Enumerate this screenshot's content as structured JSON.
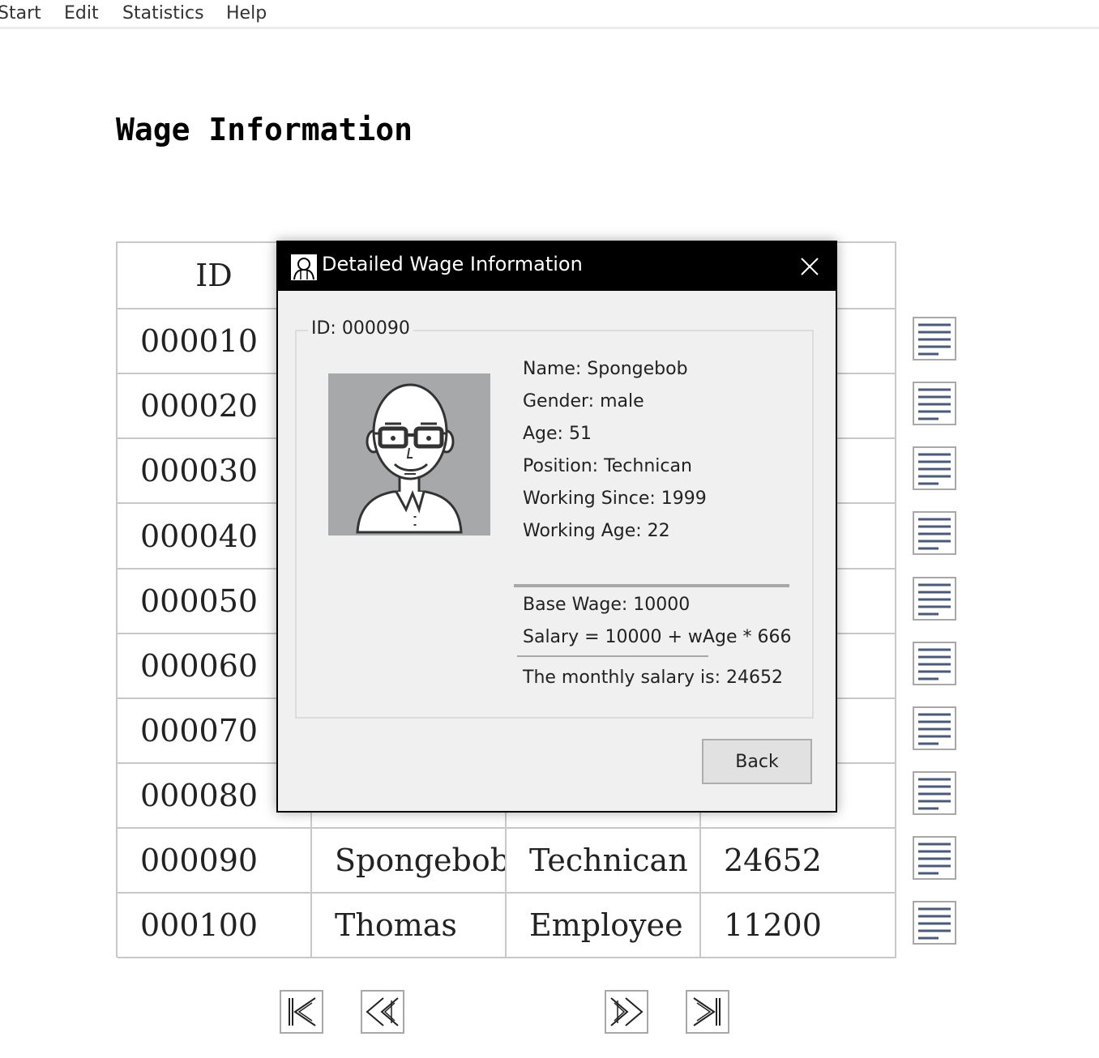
{
  "menu": {
    "items": [
      "Start",
      "Edit",
      "Statistics",
      "Help"
    ]
  },
  "page": {
    "title": "Wage Information"
  },
  "table": {
    "header": {
      "id": "ID"
    },
    "rows": [
      {
        "id": "000010"
      },
      {
        "id": "000020"
      },
      {
        "id": "000030"
      },
      {
        "id": "000040"
      },
      {
        "id": "000050"
      },
      {
        "id": "000060"
      },
      {
        "id": "000070"
      },
      {
        "id": "000080"
      },
      {
        "id": "000090",
        "name": "Spongebob",
        "position": "Technican",
        "salary": "24652"
      },
      {
        "id": "000100",
        "name": "Thomas",
        "position": "Employee",
        "salary": "11200"
      }
    ]
  },
  "dialog": {
    "title": "Detailed Wage Information",
    "group_label": "ID: 000090",
    "name": "Name: Spongebob",
    "gender": "Gender: male",
    "age": "Age: 51",
    "position": "Position: Technican",
    "working_since": "Working Since: 1999",
    "working_age": "Working Age: 22",
    "base_wage": "Base Wage: 10000",
    "formula": "Salary = 10000 + wAge * 666",
    "monthly": "The monthly salary is: 24652",
    "back_label": "Back"
  },
  "icons": {
    "detail": "list-details-icon",
    "first": "first-page-icon",
    "prev": "previous-page-icon",
    "next": "next-page-icon",
    "last": "last-page-icon",
    "close": "close-icon",
    "app": "user-app-icon",
    "avatar": "person-avatar"
  },
  "colors": {
    "titlebar": "#000000",
    "dialog_bg": "#f0f0f0",
    "grid": "#c8c8c8",
    "icon_lines": "#4a5a78"
  }
}
